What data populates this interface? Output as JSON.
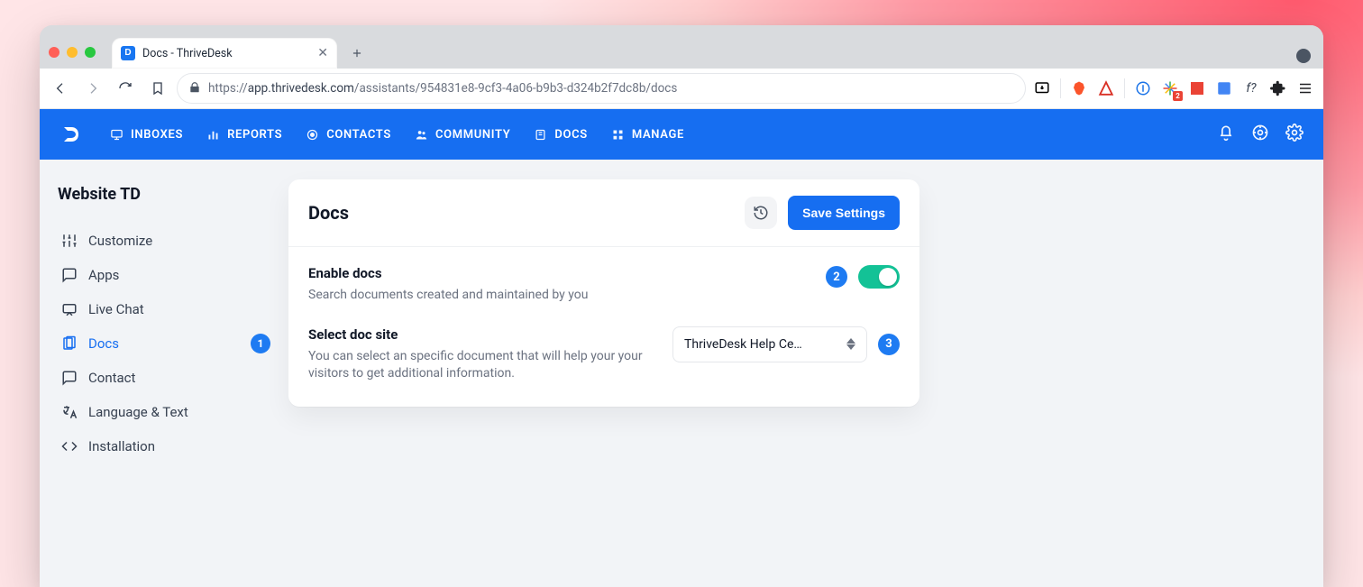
{
  "browser": {
    "tab_title": "Docs - ThriveDesk",
    "url_protocol": "https://",
    "url_host": "app.thrivedesk.com",
    "url_path": "/assistants/954831e8-9cf3-4a06-b9b3-d324b2f7dc8b/docs",
    "ext_badge_count": "2",
    "ext_fquestion": "f?"
  },
  "header": {
    "nav": {
      "inboxes": "INBOXES",
      "reports": "REPORTS",
      "contacts": "CONTACTS",
      "community": "COMMUNITY",
      "docs": "DOCS",
      "manage": "MANAGE"
    }
  },
  "sidebar": {
    "section": "Website TD",
    "items": {
      "customize": "Customize",
      "apps": "Apps",
      "livechat": "Live Chat",
      "docs": "Docs",
      "contact": "Contact",
      "language": "Language & Text",
      "installation": "Installation"
    },
    "docs_badge": "1"
  },
  "card": {
    "title": "Docs",
    "save_label": "Save Settings",
    "rows": {
      "enable": {
        "title": "Enable docs",
        "desc": "Search documents created and maintained by you",
        "badge": "2"
      },
      "site": {
        "title": "Select doc site",
        "desc": "You can select an specific document that will help your your visitors to get additional information.",
        "badge": "3",
        "selected": "ThriveDesk Help Ce…"
      }
    }
  }
}
